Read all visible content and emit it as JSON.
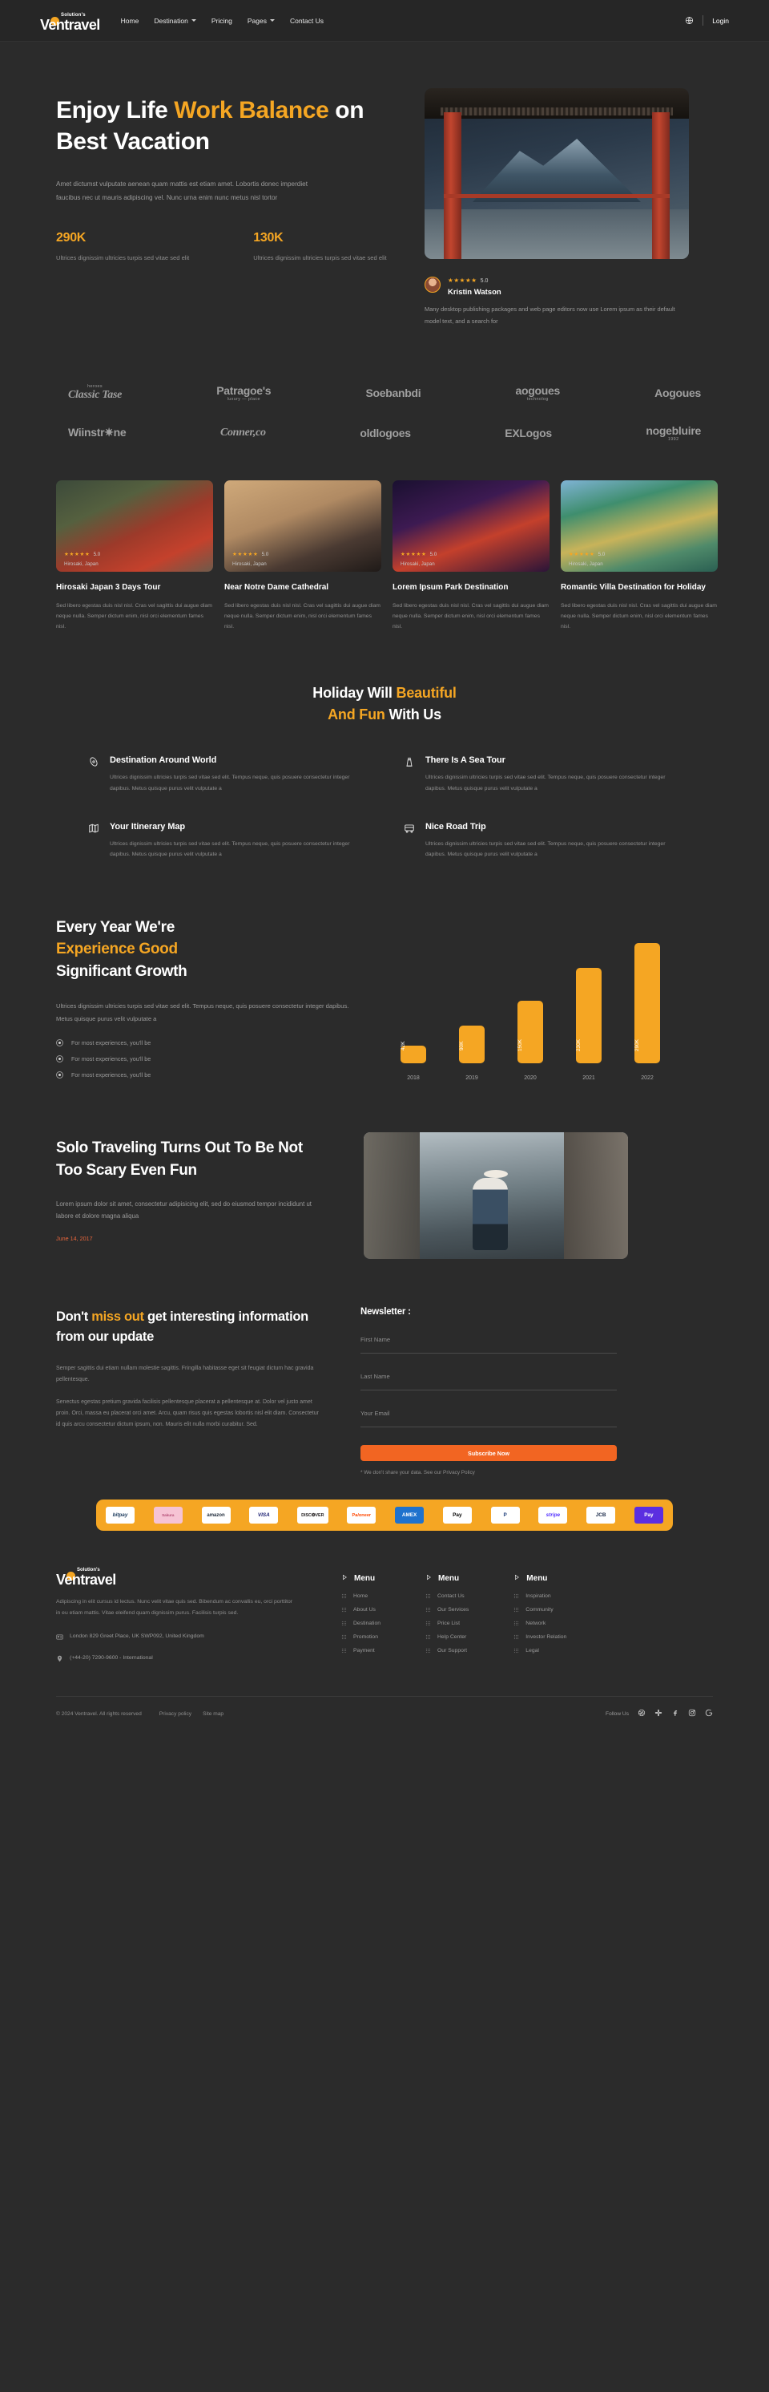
{
  "header": {
    "logo_sub": "Solution's",
    "logo_main": "Ventravel",
    "nav": [
      {
        "label": "Home",
        "caret": false
      },
      {
        "label": "Destination",
        "caret": true
      },
      {
        "label": "Pricing",
        "caret": false
      },
      {
        "label": "Pages",
        "caret": true
      },
      {
        "label": "Contact Us",
        "caret": false
      }
    ],
    "globe_icon": "globe-icon",
    "login_label": "Login"
  },
  "hero": {
    "title_1": "Enjoy Life ",
    "title_accent_1": "Work Balance",
    "title_2": " on Best Vacation",
    "description": "Amet dictumst vulputate aenean quam mattis est etiam amet. Lobortis donec imperdiet faucibus nec ut mauris adipiscing vel. Nunc urna enim nunc metus nisl tortor",
    "stats": [
      {
        "number": "290K",
        "text": "Ultrices dignissim ultricies turpis sed vitae sed elit"
      },
      {
        "number": "130K",
        "text": "Ultrices dignissim ultricies turpis sed vitae sed elit"
      }
    ],
    "testimonial": {
      "stars": "★★★★★",
      "rating": "5.0",
      "name": "Kristin Watson",
      "body": "Many desktop publishing packages and web page editors now use Lorem ipsum as their default model text, and a search for"
    }
  },
  "brands": {
    "row1": [
      {
        "sub": "heroes",
        "main": "Classic Tase",
        "italic": true
      },
      {
        "sub": "",
        "main": "Patragoe's",
        "foot": "luxury — place"
      },
      {
        "sub": "",
        "main": "Soebanbdi"
      },
      {
        "sub": "",
        "main": "aogoues",
        "foot": "technolog"
      },
      {
        "sub": "",
        "main": "Aogoues"
      }
    ],
    "row2": [
      {
        "main": "Wiinstr✷ne"
      },
      {
        "main": "Conner,co",
        "italic": true
      },
      {
        "main": "oldlogoes"
      },
      {
        "main": "EXLogos"
      },
      {
        "main": "nogebluire",
        "foot": "1992"
      }
    ]
  },
  "destinations": [
    {
      "stars": "★★★★★",
      "rating": "5.0",
      "location": "Hirosaki, Japan",
      "title": "Hirosaki Japan 3 Days Tour",
      "desc": "Sed libero egestas duis nisl nisl. Cras vel sagittis dui augue diam neque nulla. Semper dictum enim, nisl orci elementum fames nisl."
    },
    {
      "stars": "★★★★★",
      "rating": "5.0",
      "location": "Hirosaki, Japan",
      "title": "Near Notre Dame Cathedral",
      "desc": "Sed libero egestas duis nisl nisl. Cras vel sagittis dui augue diam neque nulla. Semper dictum enim, nisl orci elementum fames nisl."
    },
    {
      "stars": "★★★★★",
      "rating": "5.0",
      "location": "Hirosaki, Japan",
      "title": "Lorem Ipsum Park Destination",
      "desc": "Sed libero egestas duis nisl nisl. Cras vel sagittis dui augue diam neque nulla. Semper dictum enim, nisl orci elementum fames nisl."
    },
    {
      "stars": "★★★★★",
      "rating": "5.0",
      "location": "Hirosaki, Japan",
      "title": "Romantic Villa Destination for Holiday",
      "desc": "Sed libero egestas duis nisl nisl. Cras vel sagittis dui augue diam neque nulla. Semper dictum enim, nisl orci elementum fames nisl."
    }
  ],
  "features": {
    "title_1": "Holiday Will ",
    "title_accent_1": "Beautiful",
    "title_accent_2": "And Fun",
    "title_2": " With Us",
    "items": [
      {
        "icon": "compass-icon",
        "title": "Destination Around World",
        "desc": "Ultrices dignissim ultricies turpis sed vitae sed elit. Tempus neque, quis posuere consectetur integer dapibus. Metus quisque purus velit vulputate a"
      },
      {
        "icon": "lighthouse-icon",
        "title": "There Is A Sea Tour",
        "desc": "Ultrices dignissim ultricies turpis sed vitae sed elit. Tempus neque, quis posuere consectetur integer dapibus. Metus quisque purus velit vulputate a"
      },
      {
        "icon": "map-icon",
        "title": "Your Itinerary Map",
        "desc": "Ultrices dignissim ultricies turpis sed vitae sed elit. Tempus neque, quis posuere consectetur integer dapibus. Metus quisque purus velit vulputate a"
      },
      {
        "icon": "bus-icon",
        "title": "Nice Road Trip",
        "desc": "Ultrices dignissim ultricies turpis sed vitae sed elit. Tempus neque, quis posuere consectetur integer dapibus. Metus quisque purus velit vulputate a"
      }
    ]
  },
  "growth": {
    "title_1": "Every Year We're",
    "title_accent": "Experience Good",
    "title_2": "Significant Growth",
    "desc": "Ultrices dignissim ultricies turpis sed vitae sed elit. Tempus neque, quis posuere consectetur integer dapibus. Metus quisque purus velit vulputate a",
    "bullets": [
      "For most experiences, you'll be",
      "For most experiences, you'll be",
      "For most experiences, you'll be"
    ]
  },
  "chart_data": {
    "type": "bar",
    "title": "Every Year We're Experience Good Significant Growth",
    "categories": [
      "2018",
      "2019",
      "2020",
      "2021",
      "2022"
    ],
    "values": [
      42,
      90,
      150,
      230,
      290
    ],
    "value_labels": [
      "42K",
      "90K",
      "150K",
      "230K",
      "290K"
    ],
    "xlabel": "",
    "ylabel": "",
    "ylim": [
      0,
      320
    ],
    "grid": false,
    "legend": "none",
    "bar_color": "#f5a623"
  },
  "blog": {
    "title": "Solo Traveling Turns Out To Be Not Too Scary Even Fun",
    "desc": "Lorem ipsum dolor sit amet, consectetur adipisicing elit, sed do eiusmod tempor incididunt ut labore et dolore magna aliqua",
    "date": "June 14, 2017"
  },
  "newsletter": {
    "title_1": "Don't ",
    "title_accent": "miss out",
    "title_2": " get interesting information from our update",
    "p1": "Semper sagittis dui etiam nullam molestie sagittis. Fringilla habitasse eget sit feugiat dictum hac gravida pellentesque.",
    "p2": "Senectus egestas pretium gravida facilisis pellentesque placerat a pellentesque at. Dolor vel justo amet proin. Orci, massa eu placerat orci amet. Arcu, quam risus quis egestas lobortis nisl elit diam. Consectetur id quis arcu consectetur dictum ipsum, non. Mauris elit nulla morbi curabitur. Sed.",
    "heading": "Newsletter :",
    "first_name_placeholder": "First Name",
    "first_name_value": "",
    "last_name_placeholder": "Last Name",
    "last_name_value": "",
    "email_placeholder": "Your Email",
    "email_value": "",
    "submit_label": "Subscribe Now",
    "note": "* We don't share your data. See our Privacy Policy"
  },
  "payments": [
    {
      "name": "bitpay",
      "label": "bitpay",
      "cls": "bitpay"
    },
    {
      "name": "pink-card",
      "label": "Sakura",
      "cls": "pink"
    },
    {
      "name": "amazon",
      "label": "amazon",
      "cls": "amazon"
    },
    {
      "name": "visa",
      "label": "VISA",
      "cls": "visa"
    },
    {
      "name": "discover",
      "label": "DISC❂VER",
      "cls": "discover"
    },
    {
      "name": "payoneer",
      "label": "Pa/oneer",
      "cls": "payoneer"
    },
    {
      "name": "amex",
      "label": "AMEX",
      "cls": "amex"
    },
    {
      "name": "apple-pay",
      "label": "Pay",
      "cls": "apple"
    },
    {
      "name": "paypal",
      "label": "P",
      "cls": "paypal"
    },
    {
      "name": "stripe",
      "label": "stripe",
      "cls": "stripe"
    },
    {
      "name": "jcb",
      "label": "JCB",
      "cls": "jcb"
    },
    {
      "name": "dpay",
      "label": "Pay",
      "cls": "dpay"
    }
  ],
  "footer": {
    "logo_sub": "Solution's",
    "logo_main": "Ventravel",
    "desc": "Adipiscing in elit cursus id lectus. Nunc velit vitae quis sed. Bibendum ac convallis eu, orci porttitor in eu etiam mattis. Vitae eleifend quam dignissim purus. Facilisis turpis sed.",
    "address": "London 829 Greet Place, UK SWP092, United Kingdom",
    "phone": "(+44-20) 7290-9600 - International",
    "columns": [
      {
        "heading": "Menu",
        "links": [
          "Home",
          "About Us",
          "Destination",
          "Promotion",
          "Payment"
        ]
      },
      {
        "heading": "Menu",
        "links": [
          "Contact Us",
          "Our Services",
          "Price List",
          "Help Center",
          "Our Support"
        ]
      },
      {
        "heading": "Menu",
        "links": [
          "Inspiration",
          "Community",
          "Network",
          "Investor Relation",
          "Legal"
        ]
      }
    ],
    "copyright": "© 2024 Ventravel. All rights reserved",
    "legal": [
      "Privacy policy",
      "Site map"
    ],
    "follow_label": "Follow Us",
    "socials": [
      "dribbble-icon",
      "slack-icon",
      "facebook-icon",
      "instagram-icon",
      "google-icon"
    ]
  }
}
